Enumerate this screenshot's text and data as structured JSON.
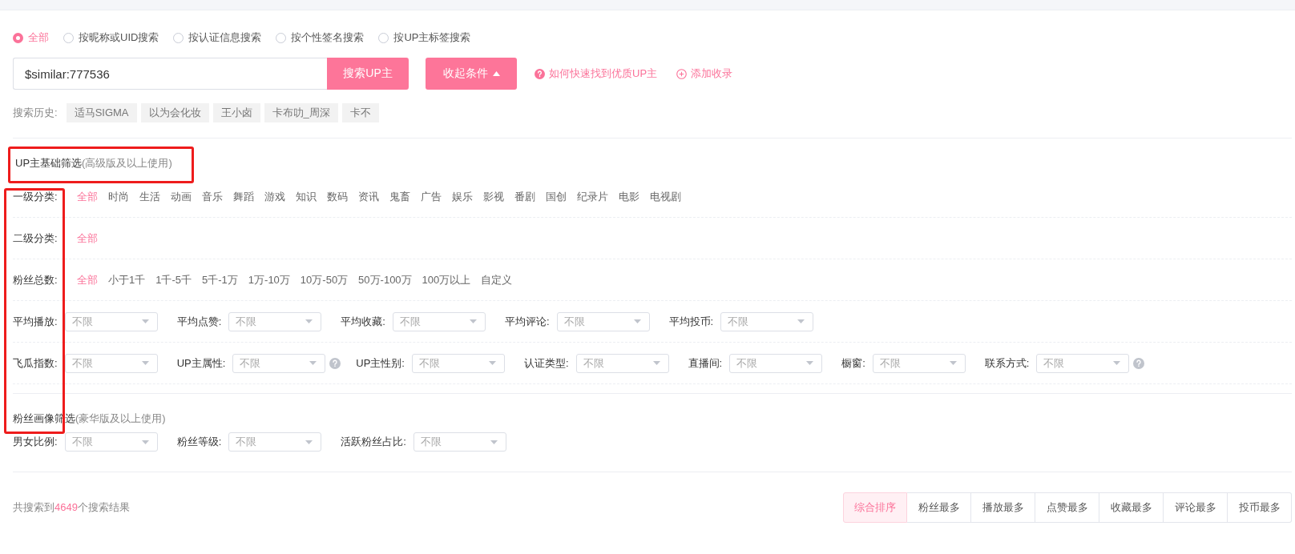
{
  "search_modes": [
    {
      "label": "全部",
      "selected": true
    },
    {
      "label": "按昵称或UID搜索",
      "selected": false
    },
    {
      "label": "按认证信息搜索",
      "selected": false
    },
    {
      "label": "按个性签名搜索",
      "selected": false
    },
    {
      "label": "按UP主标签搜索",
      "selected": false
    }
  ],
  "search": {
    "value": "$similar:777536",
    "button": "搜索UP主"
  },
  "toggle_button": {
    "label": "收起条件",
    "expanded": true
  },
  "links": [
    {
      "kind": "help",
      "label": "如何快速找到优质UP主"
    },
    {
      "kind": "add",
      "label": "添加收录"
    }
  ],
  "history": {
    "label": "搜索历史:",
    "items": [
      "适马SIGMA",
      "以为会化妆",
      "王小卤",
      "卡布叻_周深",
      "卡不"
    ]
  },
  "basic_filter": {
    "title": "UP主基础筛选",
    "note": "(高级版及以上使用)"
  },
  "filter_rows": [
    {
      "kind": "options",
      "label": "一级分类:",
      "options": [
        {
          "label": "全部",
          "selected": true
        },
        {
          "label": "时尚",
          "selected": false
        },
        {
          "label": "生活",
          "selected": false
        },
        {
          "label": "动画",
          "selected": false
        },
        {
          "label": "音乐",
          "selected": false
        },
        {
          "label": "舞蹈",
          "selected": false
        },
        {
          "label": "游戏",
          "selected": false
        },
        {
          "label": "知识",
          "selected": false
        },
        {
          "label": "数码",
          "selected": false
        },
        {
          "label": "资讯",
          "selected": false
        },
        {
          "label": "鬼畜",
          "selected": false
        },
        {
          "label": "广告",
          "selected": false
        },
        {
          "label": "娱乐",
          "selected": false
        },
        {
          "label": "影视",
          "selected": false
        },
        {
          "label": "番剧",
          "selected": false
        },
        {
          "label": "国创",
          "selected": false
        },
        {
          "label": "纪录片",
          "selected": false
        },
        {
          "label": "电影",
          "selected": false
        },
        {
          "label": "电视剧",
          "selected": false
        }
      ]
    },
    {
      "kind": "options",
      "label": "二级分类:",
      "options": [
        {
          "label": "全部",
          "selected": true
        }
      ]
    },
    {
      "kind": "options",
      "label": "粉丝总数:",
      "options": [
        {
          "label": "全部",
          "selected": true
        },
        {
          "label": "小于1千",
          "selected": false
        },
        {
          "label": "1千-5千",
          "selected": false
        },
        {
          "label": "5千-1万",
          "selected": false
        },
        {
          "label": "1万-10万",
          "selected": false
        },
        {
          "label": "10万-50万",
          "selected": false
        },
        {
          "label": "50万-100万",
          "selected": false
        },
        {
          "label": "100万以上",
          "selected": false
        },
        {
          "label": "自定义",
          "selected": false
        }
      ]
    },
    {
      "kind": "selects",
      "fields": [
        {
          "label": "平均播放:",
          "value": "不限",
          "help": false
        },
        {
          "label": "平均点赞:",
          "value": "不限",
          "help": false
        },
        {
          "label": "平均收藏:",
          "value": "不限",
          "help": false
        },
        {
          "label": "平均评论:",
          "value": "不限",
          "help": false
        },
        {
          "label": "平均投币:",
          "value": "不限",
          "help": false
        }
      ]
    },
    {
      "kind": "selects",
      "fields": [
        {
          "label": "飞瓜指数:",
          "value": "不限",
          "help": false
        },
        {
          "label": "UP主属性:",
          "value": "不限",
          "help": true
        },
        {
          "label": "UP主性别:",
          "value": "不限",
          "help": false
        },
        {
          "label": "认证类型:",
          "value": "不限",
          "help": false
        },
        {
          "label": "直播间:",
          "value": "不限",
          "help": false
        },
        {
          "label": "橱窗:",
          "value": "不限",
          "help": false
        },
        {
          "label": "联系方式:",
          "value": "不限",
          "help": true
        }
      ]
    }
  ],
  "fan_filter": {
    "title": "粉丝画像筛选",
    "note": "(豪华版及以上使用)",
    "fields": [
      {
        "label": "男女比例:",
        "value": "不限",
        "help": false
      },
      {
        "label": "粉丝等级:",
        "value": "不限",
        "help": false
      },
      {
        "label": "活跃粉丝占比:",
        "value": "不限",
        "help": false
      }
    ]
  },
  "results": {
    "text": "共搜索到",
    "count": "4649",
    "suffix": "个搜索结果"
  },
  "sort_buttons": [
    {
      "label": "综合排序",
      "selected": true
    },
    {
      "label": "粉丝最多",
      "selected": false
    },
    {
      "label": "播放最多",
      "selected": false
    },
    {
      "label": "点赞最多",
      "selected": false
    },
    {
      "label": "收藏最多",
      "selected": false
    },
    {
      "label": "评论最多",
      "selected": false
    },
    {
      "label": "投币最多",
      "selected": false
    }
  ]
}
